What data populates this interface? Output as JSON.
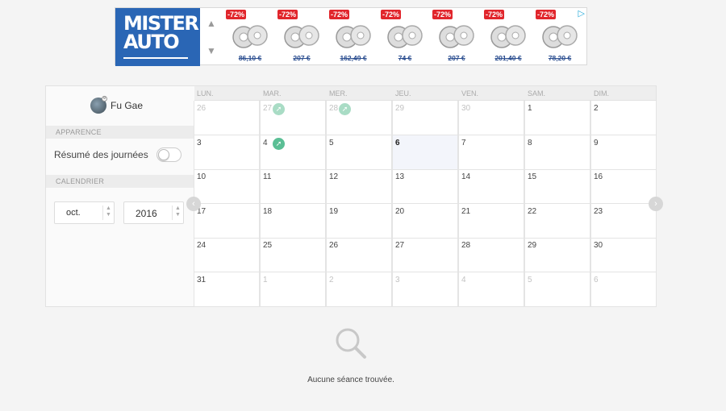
{
  "ad": {
    "brand_line1": "MISTER",
    "brand_line2": "AUTO",
    "products": [
      {
        "discount": "-72%",
        "price": "86,10 €"
      },
      {
        "discount": "-72%",
        "price": "207 €"
      },
      {
        "discount": "-72%",
        "price": "162,49 €"
      },
      {
        "discount": "-72%",
        "price": "74 €"
      },
      {
        "discount": "-72%",
        "price": "207 €"
      },
      {
        "discount": "-72%",
        "price": "201,40 €"
      },
      {
        "discount": "-72%",
        "price": "78,20 €"
      }
    ]
  },
  "user": {
    "name": "Fu Gae"
  },
  "sidebar": {
    "section_appearance": "APPARENCE",
    "toggle_label": "Résumé des journées",
    "toggle_on": false,
    "section_calendar": "CALENDRIER",
    "month_value": "oct.",
    "year_value": "2016"
  },
  "calendar": {
    "day_headers": [
      "LUN.",
      "MAR.",
      "MER.",
      "JEU.",
      "VEN.",
      "SAM.",
      "DIM."
    ],
    "weeks": [
      [
        {
          "d": "26",
          "o": true
        },
        {
          "d": "27",
          "o": true,
          "ev": true
        },
        {
          "d": "28",
          "o": true,
          "ev": true
        },
        {
          "d": "29",
          "o": true
        },
        {
          "d": "30",
          "o": true
        },
        {
          "d": "1"
        },
        {
          "d": "2"
        }
      ],
      [
        {
          "d": "3"
        },
        {
          "d": "4",
          "ev": true
        },
        {
          "d": "5"
        },
        {
          "d": "6",
          "today": true
        },
        {
          "d": "7"
        },
        {
          "d": "8"
        },
        {
          "d": "9"
        }
      ],
      [
        {
          "d": "10"
        },
        {
          "d": "11"
        },
        {
          "d": "12"
        },
        {
          "d": "13"
        },
        {
          "d": "14"
        },
        {
          "d": "15"
        },
        {
          "d": "16"
        }
      ],
      [
        {
          "d": "17"
        },
        {
          "d": "18"
        },
        {
          "d": "19"
        },
        {
          "d": "20"
        },
        {
          "d": "21"
        },
        {
          "d": "22"
        },
        {
          "d": "23"
        }
      ],
      [
        {
          "d": "24"
        },
        {
          "d": "25"
        },
        {
          "d": "26"
        },
        {
          "d": "27"
        },
        {
          "d": "28"
        },
        {
          "d": "29"
        },
        {
          "d": "30"
        }
      ],
      [
        {
          "d": "31"
        },
        {
          "d": "1",
          "o": true
        },
        {
          "d": "2",
          "o": true
        },
        {
          "d": "3",
          "o": true
        },
        {
          "d": "4",
          "o": true
        },
        {
          "d": "5",
          "o": true
        },
        {
          "d": "6",
          "o": true
        }
      ]
    ]
  },
  "empty_state": {
    "message": "Aucune séance trouvée.",
    "icon": "search-icon"
  },
  "colors": {
    "accent_green": "#5bbf95",
    "brand_blue": "#2a66b5",
    "discount_red": "#e1262c"
  }
}
